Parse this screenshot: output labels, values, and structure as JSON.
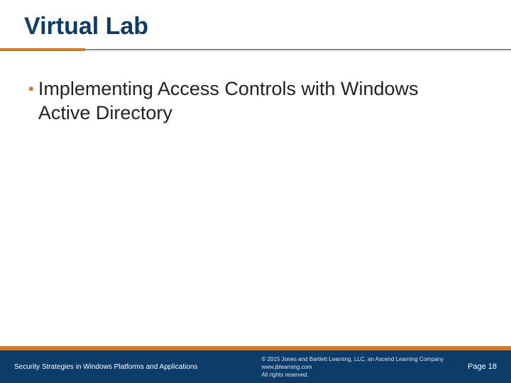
{
  "title": "Virtual Lab",
  "bullets": [
    {
      "text": "Implementing Access Controls with Windows Active Directory"
    }
  ],
  "footer": {
    "left": "Security Strategies in Windows Platforms and Applications",
    "copyright_line1": "© 2015 Jones and Bartlett Learning, LLC, an Ascend Learning Company",
    "copyright_line2": "www.jblearning.com",
    "copyright_line3": "All rights reserved.",
    "page_label": "Page 18"
  }
}
